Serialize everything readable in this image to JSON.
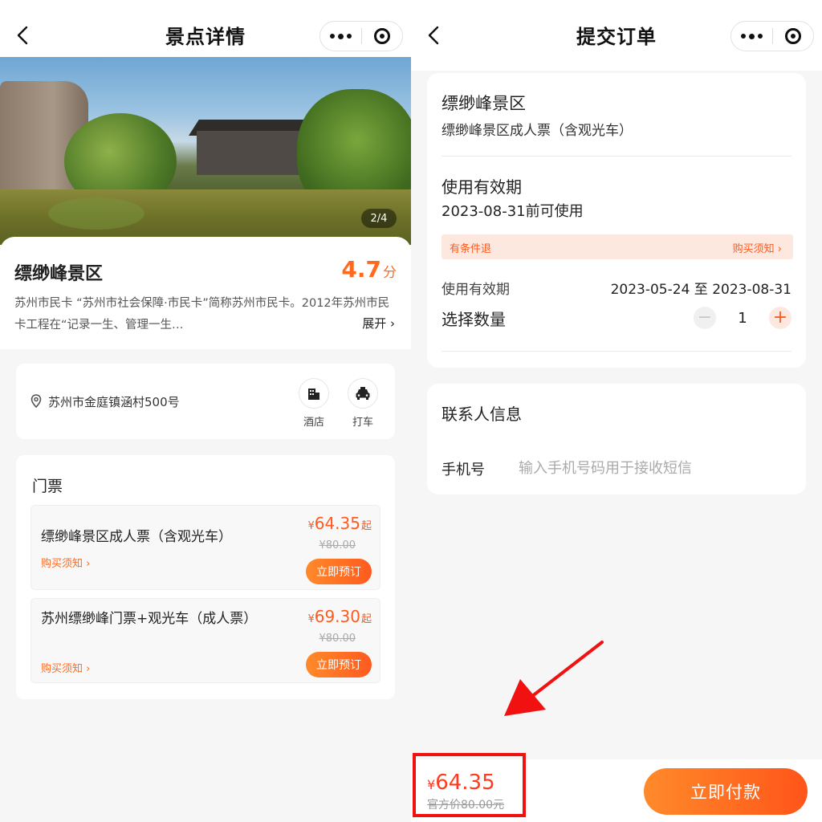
{
  "left": {
    "nav": {
      "title": "景点详情"
    },
    "gallery": {
      "counter": "2/4"
    },
    "spot": {
      "name": "缥缈峰景区",
      "rating": "4.7",
      "rating_unit": "分",
      "description": "苏州市民卡 “苏州市社会保障·市民卡”简称苏州市民卡。2012年苏州市民卡工程在“记录一生、管理一生…",
      "expand_label": "展开"
    },
    "address": {
      "text": "苏州市金庭镇涵村500号",
      "hotel_label": "酒店",
      "taxi_label": "打车"
    },
    "tickets": {
      "heading": "门票",
      "items": [
        {
          "name": "缥缈峰景区成人票（含观光车）",
          "currency": "¥",
          "price": "64.35",
          "price_suffix": "起",
          "original": "¥80.00",
          "notice": "购买须知",
          "book": "立即预订"
        },
        {
          "name": "苏州缥缈峰门票+观光车（成人票）",
          "currency": "¥",
          "price": "69.30",
          "price_suffix": "起",
          "original": "¥80.00",
          "notice": "购买须知",
          "book": "立即预订"
        }
      ]
    }
  },
  "right": {
    "nav": {
      "title": "提交订单"
    },
    "order": {
      "spot_name": "缥缈峰景区",
      "ticket_name": "缥缈峰景区成人票（含观光车）",
      "validity_heading": "使用有效期",
      "validity_value": "2023-08-31前可使用",
      "refund_tag": "有条件退",
      "purchase_notice": "购买须知",
      "validity_label": "使用有效期",
      "validity_range": "2023-05-24 至 2023-08-31",
      "quantity_label": "选择数量",
      "quantity": "1"
    },
    "contact": {
      "heading": "联系人信息",
      "phone_label": "手机号",
      "phone_placeholder": "输入手机号码用于接收短信"
    },
    "footer": {
      "currency": "¥",
      "price": "64.35",
      "official_price": "官方价80.00元",
      "pay_label": "立即付款"
    }
  },
  "colors": {
    "accent": "#ff5a1f",
    "highlight": "#f21111"
  }
}
